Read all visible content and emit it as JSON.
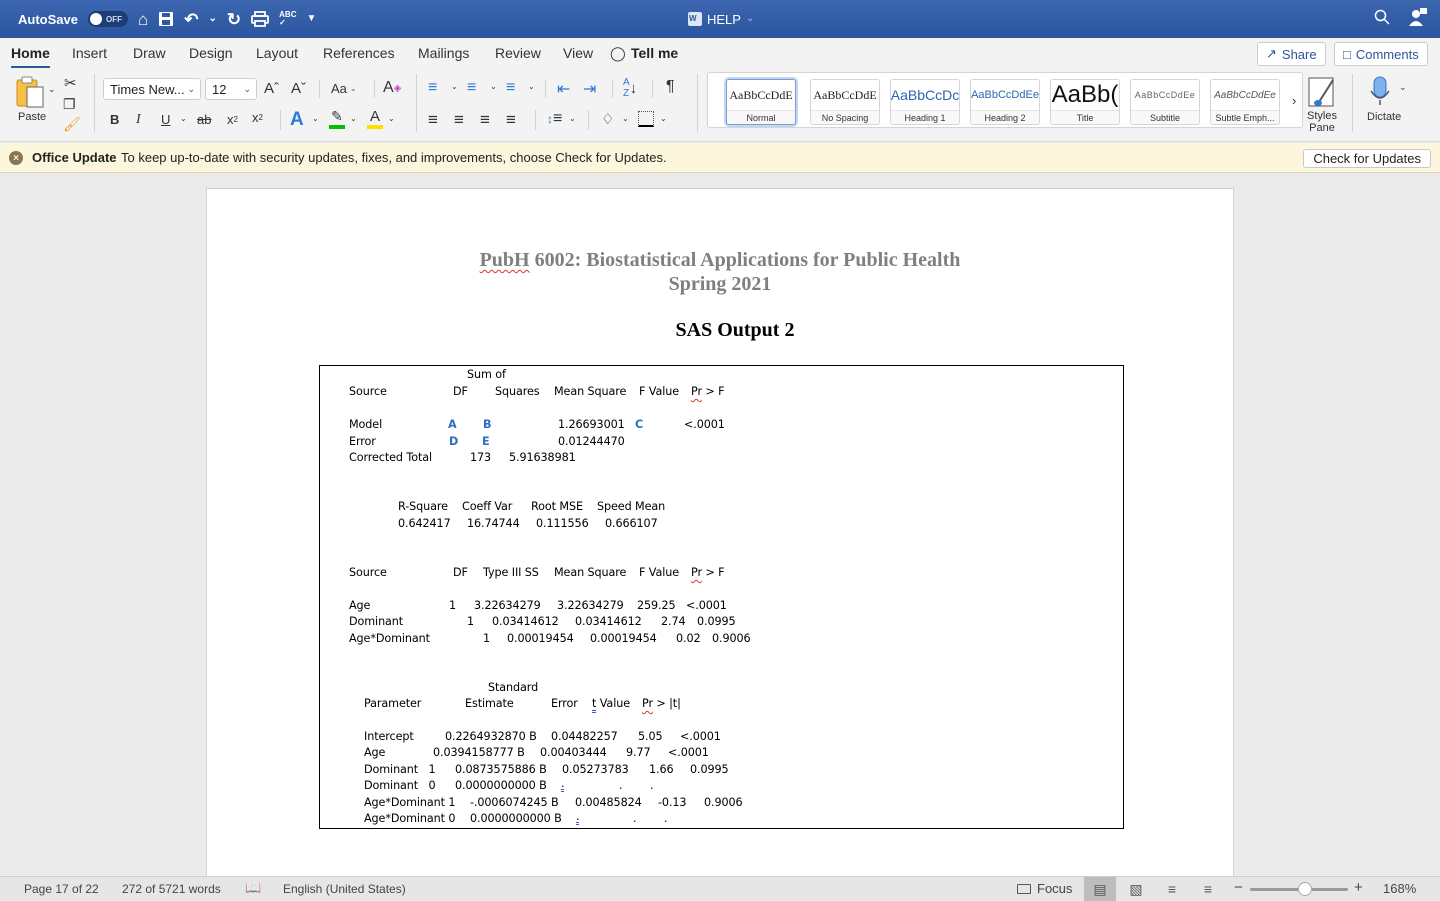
{
  "titlebar": {
    "autosave_label": "AutoSave",
    "autosave_state": "OFF",
    "doc_title": "HELP",
    "icons": [
      "home-icon",
      "save-icon",
      "undo-icon",
      "redo-icon",
      "print-icon",
      "spelling-icon",
      "customize-icon",
      "search-icon",
      "account-icon"
    ]
  },
  "tabs": [
    {
      "label": "Home",
      "active": true
    },
    {
      "label": "Insert"
    },
    {
      "label": "Draw"
    },
    {
      "label": "Design"
    },
    {
      "label": "Layout"
    },
    {
      "label": "References"
    },
    {
      "label": "Mailings"
    },
    {
      "label": "Review"
    },
    {
      "label": "View"
    },
    {
      "label": "Tell me"
    }
  ],
  "share_label": "Share",
  "comments_label": "Comments",
  "ribbon": {
    "paste_label": "Paste",
    "font_name": "Times New...",
    "font_size": "12",
    "change_case_label": "Aa",
    "styles": [
      {
        "preview": "AaBbCcDdE",
        "label": "Normal",
        "selected": true
      },
      {
        "preview": "AaBbCcDdE",
        "label": "No Spacing"
      },
      {
        "preview": "AaBbCcDc",
        "label": "Heading 1"
      },
      {
        "preview": "AaBbCcDdEe",
        "label": "Heading 2"
      },
      {
        "preview": "AaBb(",
        "label": "Title"
      },
      {
        "preview": "AaBbCcDdEe",
        "label": "Subtitle"
      },
      {
        "preview": "AaBbCcDdEe",
        "label": "Subtle Emph..."
      }
    ],
    "styles_pane_label": "Styles Pane",
    "dictate_label": "Dictate",
    "highlight_color": "#00c000",
    "font_color": "#ffe000"
  },
  "notice": {
    "title": "Office Update",
    "message": "To keep up-to-date with security updates, fixes, and improvements, choose Check for Updates.",
    "button": "Check for Updates"
  },
  "document": {
    "course_code": "PubH",
    "course_title_rest": " 6002: Biostatistical Applications for Public Health",
    "term": "Spring 2021",
    "heading": "SAS Output 2",
    "anova": {
      "header_top": "Sum of",
      "headers": [
        "Source",
        "DF",
        "Squares",
        "Mean Square",
        "F Value",
        "Pr > F"
      ],
      "rows": [
        {
          "source": "Model",
          "df": "A",
          "ss": "B",
          "ms": "1.26693001",
          "f": "C",
          "p": "<.0001"
        },
        {
          "source": "Error",
          "df": "D",
          "ss": "E",
          "ms": "0.01244470",
          "f": "",
          "p": ""
        },
        {
          "source": "Corrected Total",
          "df": "173",
          "ss": "5.91638981",
          "ms": "",
          "f": "",
          "p": ""
        }
      ]
    },
    "fit": {
      "headers": [
        "R-Square",
        "Coeff Var",
        "Root MSE",
        "Speed Mean"
      ],
      "values": [
        "0.642417",
        "16.74744",
        "0.111556",
        "0.666107"
      ]
    },
    "type3": {
      "headers": [
        "Source",
        "DF",
        "Type III SS",
        "Mean Square",
        "F Value",
        "Pr > F"
      ],
      "rows": [
        {
          "source": "Age",
          "df": "1",
          "ss": "3.22634279",
          "ms": "3.22634279",
          "f": "259.25",
          "p": "<.0001"
        },
        {
          "source": "Dominant",
          "df": "1",
          "ss": "0.03414612",
          "ms": "0.03414612",
          "f": "2.74",
          "p": "0.0995"
        },
        {
          "source": "Age*Dominant",
          "df": "1",
          "ss": "0.00019454",
          "ms": "0.00019454",
          "f": "0.02",
          "p": "0.9006"
        }
      ]
    },
    "params": {
      "header_top": "Standard",
      "headers": [
        "Parameter",
        "Estimate",
        "Error",
        "t Value",
        "Pr > |t|"
      ],
      "rows": [
        {
          "param": "Intercept",
          "est": "0.2264932870 B",
          "se": "0.04482257",
          "t": "5.05",
          "p": "<.0001"
        },
        {
          "param": "Age",
          "est": "0.0394158777 B",
          "se": "0.00403444",
          "t": "9.77",
          "p": "<.0001"
        },
        {
          "param": "Dominant   1",
          "est": "0.0873575886 B",
          "se": "0.05273783",
          "t": "1.66",
          "p": "0.0995"
        },
        {
          "param": "Dominant   0",
          "est": "0.0000000000 B",
          "se": ".",
          "t": ".",
          "p": "."
        },
        {
          "param": "Age*Dominant 1",
          "est": "-.0006074245 B",
          "se": "0.00485824",
          "t": "-0.13",
          "p": "0.9006"
        },
        {
          "param": "Age*Dominant 0",
          "est": "0.0000000000 B",
          "se": ".",
          "t": ".",
          "p": "."
        }
      ]
    }
  },
  "status": {
    "page": "Page 17 of 22",
    "words": "272 of 5721 words",
    "language": "English (United States)",
    "focus_label": "Focus",
    "zoom": "168%",
    "zoom_percent": 168
  }
}
